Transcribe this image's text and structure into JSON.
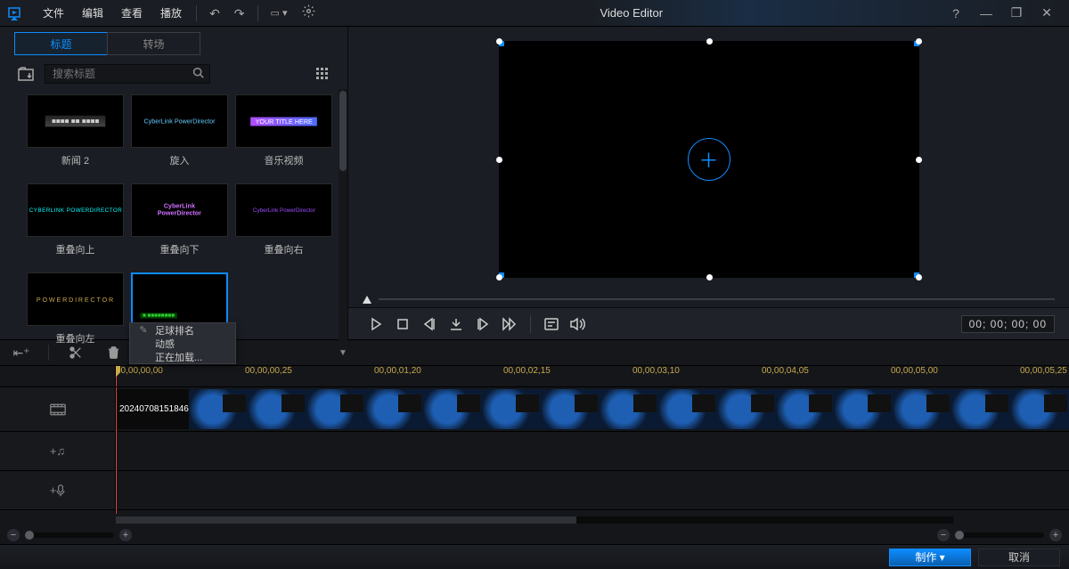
{
  "app_title": "Video Editor",
  "menu": [
    "文件",
    "编辑",
    "查看",
    "播放"
  ],
  "window_controls": {
    "help": "?",
    "min": "—",
    "max": "❐",
    "close": "✕"
  },
  "tabs": [
    {
      "label": "标题",
      "active": true
    },
    {
      "label": "转场",
      "active": false
    }
  ],
  "search": {
    "placeholder": "搜索标题"
  },
  "thumbs": [
    {
      "label": "新闻 2",
      "art": "news"
    },
    {
      "label": "旋入",
      "art": "spin"
    },
    {
      "label": "音乐视频",
      "art": "music"
    },
    {
      "label": "重叠向上",
      "art": "up"
    },
    {
      "label": "重叠向下",
      "art": "down"
    },
    {
      "label": "重叠向右",
      "art": "right"
    },
    {
      "label": "重叠向左",
      "art": "left"
    },
    {
      "label": "",
      "art": "selected",
      "selected": true
    }
  ],
  "context_menu": [
    {
      "icon": "pencil",
      "label": "足球排名"
    },
    {
      "icon": "",
      "label": "动感"
    },
    {
      "icon": "",
      "label": "正在加载..."
    }
  ],
  "timecode": "00; 00; 00; 00",
  "ruler_ticks": [
    "00,00,00,00",
    "00,00,00,25",
    "00,00,01,20",
    "00,00,02,15",
    "00,00,03,10",
    "00,00,04,05",
    "00,00,05,00",
    "00,00,05,25"
  ],
  "clip": {
    "label": "20240708151846"
  },
  "footer": {
    "produce": "制作",
    "cancel": "取消"
  }
}
